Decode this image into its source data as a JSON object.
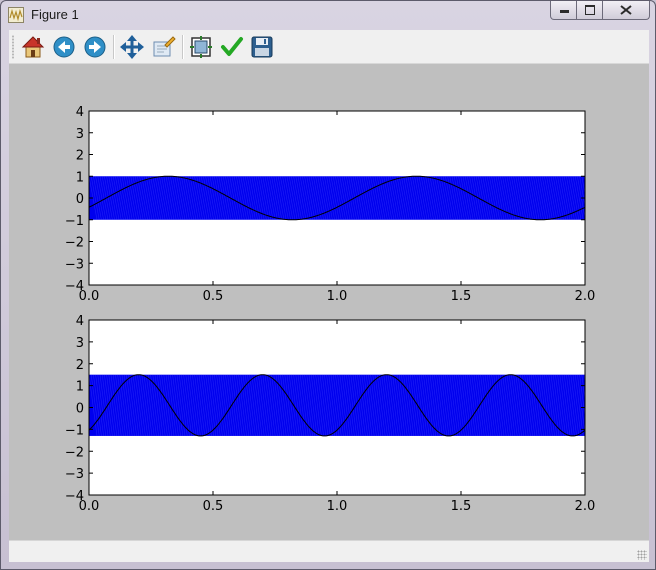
{
  "window": {
    "title": "Figure 1",
    "app_icon": "matplotlib-figure-icon",
    "controls": [
      "minimize-icon",
      "maximize-icon",
      "close-icon"
    ]
  },
  "toolbar": {
    "buttons": [
      {
        "name": "home-button",
        "icon": "home-icon"
      },
      {
        "name": "back-button",
        "icon": "arrow-left-icon"
      },
      {
        "name": "forward-button",
        "icon": "arrow-right-icon"
      },
      {
        "name": "pan-button",
        "icon": "move-arrows-icon"
      },
      {
        "name": "zoom-button",
        "icon": "zoom-rect-icon"
      },
      {
        "name": "subplots-button",
        "icon": "configure-subplots-icon"
      },
      {
        "name": "edit-axis-button",
        "icon": "checkmark-icon"
      },
      {
        "name": "save-button",
        "icon": "floppy-disk-icon"
      }
    ]
  },
  "colors": {
    "figure_bg": "#bfbfbf",
    "band": "#0000ee",
    "curve": "#000000"
  },
  "chart_data": [
    {
      "type": "area",
      "xlim": [
        0.0,
        2.0
      ],
      "ylim": [
        -4,
        4
      ],
      "xticks": [
        "0.0",
        "0.5",
        "1.0",
        "1.5",
        "2.0"
      ],
      "yticks": [
        "4",
        "3",
        "2",
        "1",
        "0",
        "−1",
        "−2",
        "−3",
        "−4"
      ],
      "band": {
        "y_min": -1.0,
        "y_max": 1.0
      },
      "curve": {
        "function": "sin",
        "amplitude": 1.0,
        "period": 1.0,
        "peak_x": 0.32
      }
    },
    {
      "type": "area",
      "xlim": [
        0.0,
        2.0
      ],
      "ylim": [
        -4,
        4
      ],
      "xticks": [
        "0.0",
        "0.5",
        "1.0",
        "1.5",
        "2.0"
      ],
      "yticks": [
        "4",
        "3",
        "2",
        "1",
        "0",
        "−1",
        "−2",
        "−3",
        "−4"
      ],
      "band": {
        "y_min": -1.3,
        "y_max": 1.5
      },
      "curve": {
        "function": "sin",
        "amplitude": 1.4,
        "offset": 0.1,
        "period": 0.5,
        "peak_x": 0.2
      }
    }
  ]
}
